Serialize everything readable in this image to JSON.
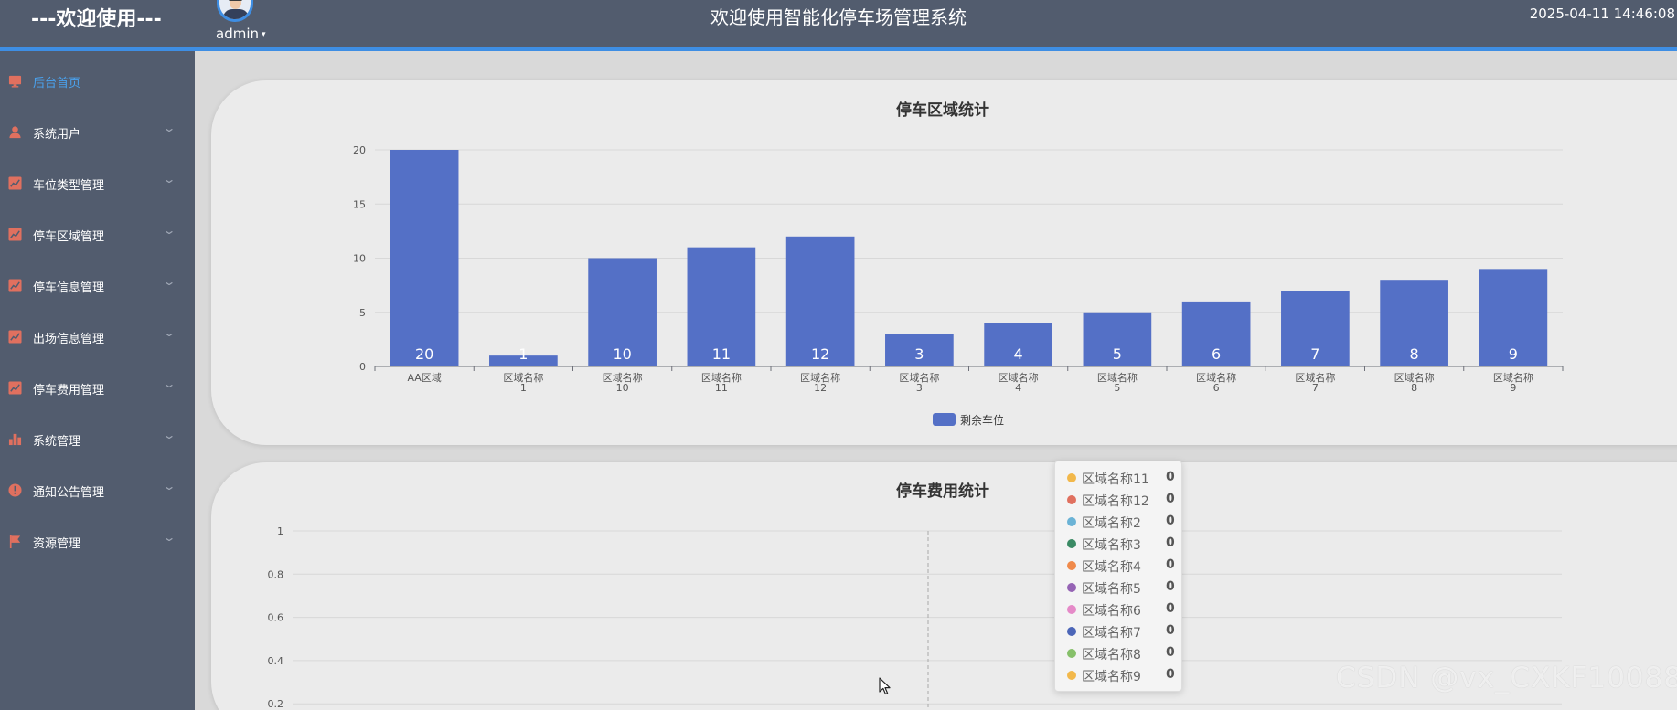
{
  "header": {
    "welcome": "---欢迎使用---",
    "username": "admin",
    "caret": "▾",
    "title": "欢迎使用智能化停车场管理系统",
    "datetime": "2025-04-11 14:46:08"
  },
  "colors": {
    "header_bg": "#525c6e",
    "accent": "#3e8ee4",
    "active_menu": "#4aa3f0",
    "menu_icon": "#e0705f",
    "bar": "#5470c6"
  },
  "sidebar": {
    "items": [
      {
        "label": "后台首页",
        "icon": "monitor-icon",
        "active": true,
        "arrow": ""
      },
      {
        "label": "系统用户",
        "icon": "user-icon",
        "active": false,
        "arrow": "⌄"
      },
      {
        "label": "车位类型管理",
        "icon": "line-chart-icon",
        "active": false,
        "arrow": "⌄"
      },
      {
        "label": "停车区域管理",
        "icon": "line-chart-icon",
        "active": false,
        "arrow": "⌄"
      },
      {
        "label": "停车信息管理",
        "icon": "line-chart-icon",
        "active": false,
        "arrow": "⌄"
      },
      {
        "label": "出场信息管理",
        "icon": "line-chart-icon",
        "active": false,
        "arrow": "⌄"
      },
      {
        "label": "停车费用管理",
        "icon": "line-chart-icon",
        "active": false,
        "arrow": "⌄"
      },
      {
        "label": "系统管理",
        "icon": "bar-chart-icon",
        "active": false,
        "arrow": "⌄"
      },
      {
        "label": "通知公告管理",
        "icon": "info-icon",
        "active": false,
        "arrow": "⌄"
      },
      {
        "label": "资源管理",
        "icon": "flag-icon",
        "active": false,
        "arrow": "⌄"
      }
    ]
  },
  "charts": {
    "area_title": "停车区域统计",
    "fee_title": "停车费用统计"
  },
  "chart_data": [
    {
      "type": "bar",
      "title": "停车区域统计",
      "categories": [
        "AA区域",
        "区域名称\n1",
        "区域名称\n10",
        "区域名称\n11",
        "区域名称\n12",
        "区域名称\n3",
        "区域名称\n4",
        "区域名称\n5",
        "区域名称\n6",
        "区域名称\n7",
        "区域名称\n8",
        "区域名称\n9"
      ],
      "series": [
        {
          "name": "剩余车位",
          "values": [
            20,
            1,
            10,
            11,
            12,
            3,
            4,
            5,
            6,
            7,
            8,
            9
          ]
        }
      ],
      "ylim": [
        0,
        20
      ],
      "yticks": [
        0,
        5,
        10,
        15,
        20
      ],
      "grid": true,
      "legend": "bottom-center"
    },
    {
      "type": "line",
      "title": "停车费用统计",
      "ylim": [
        0,
        1
      ],
      "yticks_visible": [
        "1",
        "0.8",
        "0.6",
        "0.4",
        "0.2"
      ],
      "grid": true,
      "tooltip": [
        {
          "name": "区域名称11",
          "value": "0",
          "color": "#f2b84b"
        },
        {
          "name": "区域名称12",
          "value": "0",
          "color": "#e0705f"
        },
        {
          "name": "区域名称2",
          "value": "0",
          "color": "#6bb3d6"
        },
        {
          "name": "区域名称3",
          "value": "0",
          "color": "#3a8a64"
        },
        {
          "name": "区域名称4",
          "value": "0",
          "color": "#f08a4b"
        },
        {
          "name": "区域名称5",
          "value": "0",
          "color": "#9563b4"
        },
        {
          "name": "区域名称6",
          "value": "0",
          "color": "#e58ac8"
        },
        {
          "name": "区域名称7",
          "value": "0",
          "color": "#4c66b8"
        },
        {
          "name": "区域名称8",
          "value": "0",
          "color": "#86c06a"
        },
        {
          "name": "区域名称9",
          "value": "0",
          "color": "#f2b84b"
        }
      ]
    }
  ],
  "watermark": "CSDN @vx_CXKF10088"
}
